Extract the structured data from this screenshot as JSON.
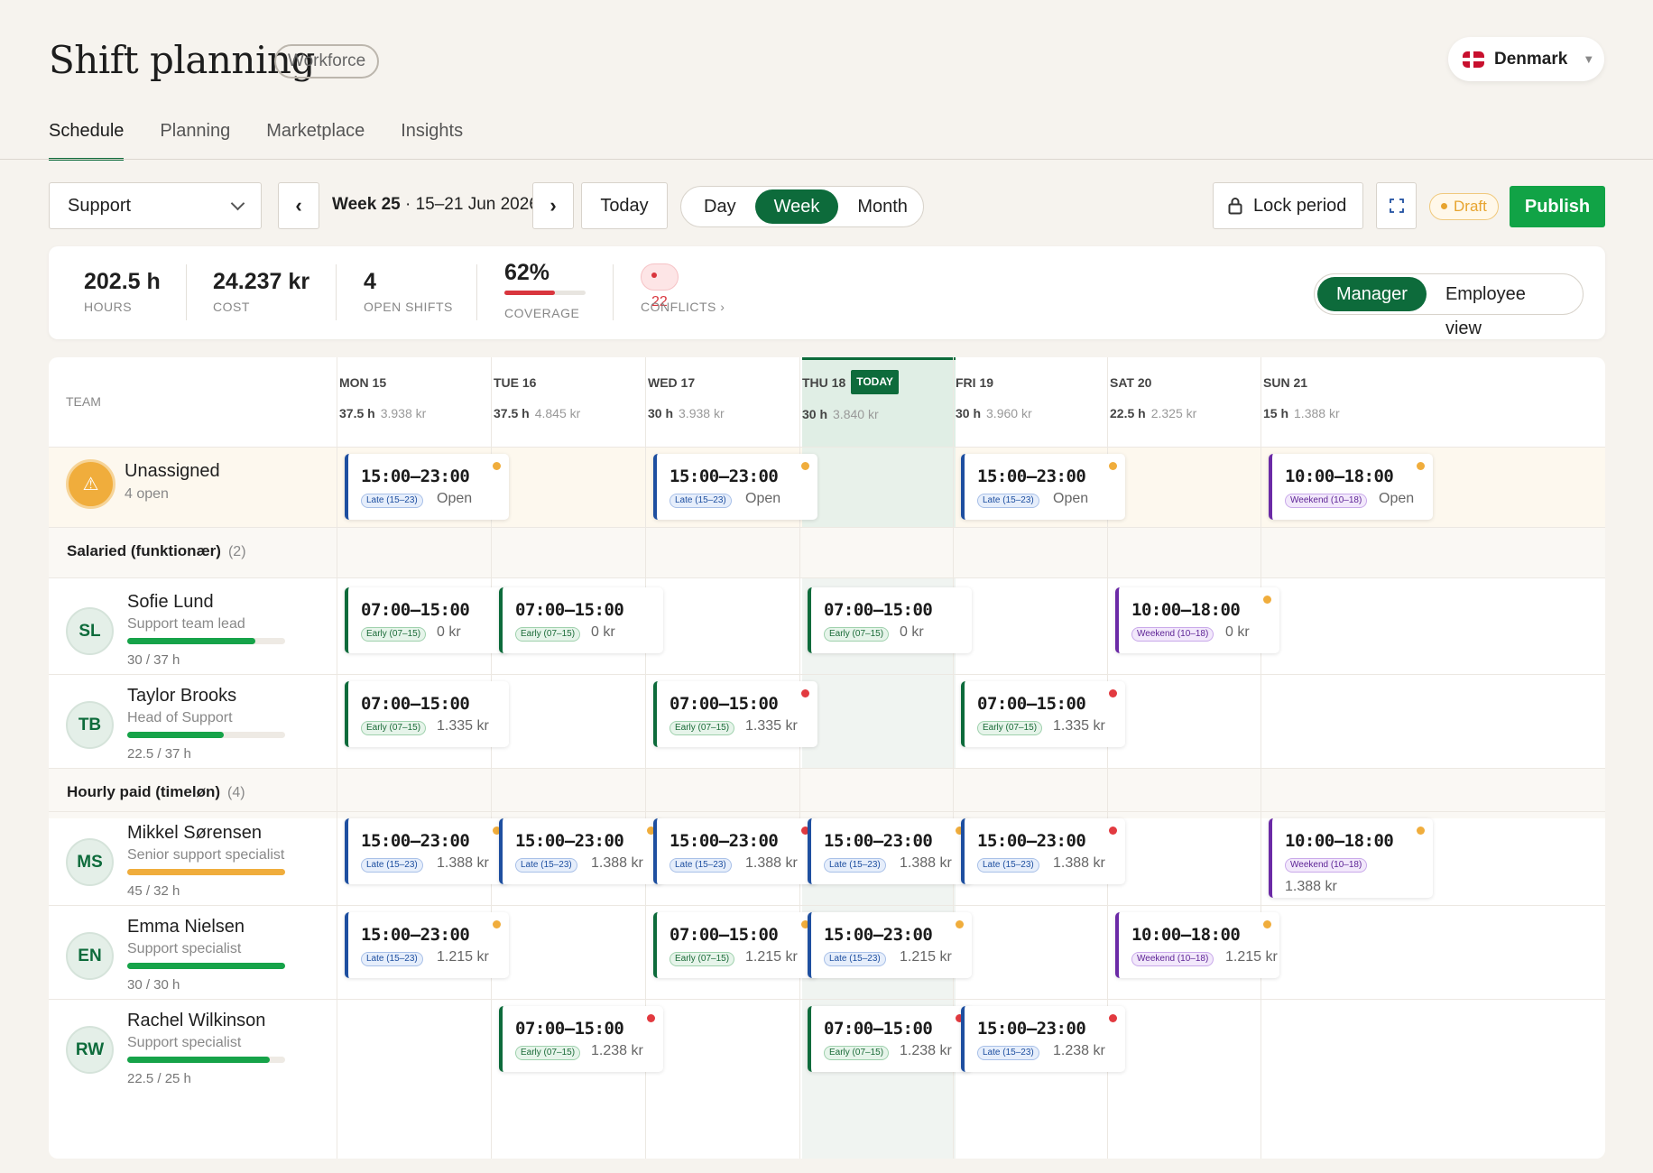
{
  "header": {
    "title": "Shift planning",
    "badge": "Workforce",
    "country": "Denmark"
  },
  "tabs": [
    "Schedule",
    "Planning",
    "Marketplace",
    "Insights"
  ],
  "toolbar": {
    "team": "Support",
    "prev": "‹",
    "next": "›",
    "week_bold": "Week 25",
    "week_range": " · 15–21 Jun 2026",
    "today": "Today",
    "views": [
      "Day",
      "Week",
      "Month"
    ],
    "active_view": "Week",
    "lock": "Lock period",
    "draft": "Draft",
    "publish": "Publish"
  },
  "stats": {
    "hours": {
      "value": "202.5 h",
      "label": "HOURS"
    },
    "cost": {
      "value": "24.237 kr",
      "label": "COST"
    },
    "open": {
      "value": "4",
      "label": "OPEN SHIFTS"
    },
    "coverage": {
      "value": "62%",
      "label": "COVERAGE",
      "percent": 62
    },
    "conflicts": {
      "value": "22",
      "label": "CONFLICTS ›"
    },
    "roles": [
      "Manager",
      "Employee view"
    ]
  },
  "grid": {
    "team_header": "TEAM",
    "today_badge": "TODAY",
    "days": [
      {
        "name": "MON 15",
        "hours": "37.5 h",
        "cost": "3.938 kr"
      },
      {
        "name": "TUE 16",
        "hours": "37.5 h",
        "cost": "4.845 kr"
      },
      {
        "name": "WED 17",
        "hours": "30 h",
        "cost": "3.938 kr"
      },
      {
        "name": "THU 18",
        "hours": "30 h",
        "cost": "3.840 kr"
      },
      {
        "name": "FRI 19",
        "hours": "30 h",
        "cost": "3.960 kr"
      },
      {
        "name": "SAT 20",
        "hours": "22.5 h",
        "cost": "2.325 kr"
      },
      {
        "name": "SUN 21",
        "hours": "15 h",
        "cost": "1.388 kr"
      }
    ],
    "unassigned": {
      "name": "Unassigned",
      "sub": "4 open"
    },
    "sections": [
      {
        "title": "Salaried (funktionær)",
        "count": "(2)"
      },
      {
        "title": "Hourly paid (timeløn)",
        "count": "(4)"
      }
    ],
    "people": [
      {
        "initials": "SL",
        "name": "Sofie Lund",
        "role": "Support team lead",
        "hours": "30 / 37 h",
        "utilization": 0.81
      },
      {
        "initials": "TB",
        "name": "Taylor Brooks",
        "role": "Head of Support",
        "hours": "22.5 / 37 h",
        "utilization": 0.61
      },
      {
        "initials": "MS",
        "name": "Mikkel Sørensen",
        "role": "Senior support specialist",
        "hours": "45 / 32 h",
        "utilization": 1.0,
        "over": true
      },
      {
        "initials": "EN",
        "name": "Emma Nielsen",
        "role": "Support specialist",
        "hours": "30 / 30 h",
        "utilization": 1.0
      },
      {
        "initials": "RW",
        "name": "Rachel Wilkinson",
        "role": "Support specialist",
        "hours": "22.5 / 25 h",
        "utilization": 0.9
      }
    ],
    "shifts": [
      {
        "row": 0,
        "day": 0,
        "time": "15:00–23:00",
        "tag": "Late (15–23)",
        "kind": "late",
        "info": "Open",
        "dot": "warn"
      },
      {
        "row": 0,
        "day": 2,
        "time": "15:00–23:00",
        "tag": "Late (15–23)",
        "kind": "late",
        "info": "Open",
        "dot": "warn"
      },
      {
        "row": 0,
        "day": 4,
        "time": "15:00–23:00",
        "tag": "Late (15–23)",
        "kind": "late",
        "info": "Open",
        "dot": "warn"
      },
      {
        "row": 0,
        "day": 6,
        "time": "10:00–18:00",
        "tag": "Weekend (10–18)",
        "kind": "weekend",
        "info": "Open",
        "dot": "warn"
      },
      {
        "row": 1,
        "day": 0,
        "time": "07:00–15:00",
        "tag": "Early (07–15)",
        "kind": "early",
        "info": "0 kr",
        "dot": ""
      },
      {
        "row": 1,
        "day": 1,
        "time": "07:00–15:00",
        "tag": "Early (07–15)",
        "kind": "early",
        "info": "0 kr",
        "dot": ""
      },
      {
        "row": 1,
        "day": 3,
        "time": "07:00–15:00",
        "tag": "Early (07–15)",
        "kind": "early",
        "info": "0 kr",
        "dot": ""
      },
      {
        "row": 1,
        "day": 5,
        "time": "10:00–18:00",
        "tag": "Weekend (10–18)",
        "kind": "weekend",
        "info": "0 kr",
        "dot": "warn"
      },
      {
        "row": 2,
        "day": 0,
        "time": "07:00–15:00",
        "tag": "Early (07–15)",
        "kind": "early",
        "info": "1.335 kr",
        "dot": ""
      },
      {
        "row": 2,
        "day": 2,
        "time": "07:00–15:00",
        "tag": "Early (07–15)",
        "kind": "early",
        "info": "1.335 kr",
        "dot": "err"
      },
      {
        "row": 2,
        "day": 4,
        "time": "07:00–15:00",
        "tag": "Early (07–15)",
        "kind": "early",
        "info": "1.335 kr",
        "dot": "err"
      },
      {
        "row": 3,
        "day": 0,
        "time": "15:00–23:00",
        "tag": "Late (15–23)",
        "kind": "late",
        "info": "1.388 kr",
        "dot": "warn"
      },
      {
        "row": 3,
        "day": 1,
        "time": "15:00–23:00",
        "tag": "Late (15–23)",
        "kind": "late",
        "info": "1.388 kr",
        "dot": "warn"
      },
      {
        "row": 3,
        "day": 2,
        "time": "15:00–23:00",
        "tag": "Late (15–23)",
        "kind": "late",
        "info": "1.388 kr",
        "dot": "err"
      },
      {
        "row": 3,
        "day": 3,
        "time": "15:00–23:00",
        "tag": "Late (15–23)",
        "kind": "late",
        "info": "1.388 kr",
        "dot": "warn"
      },
      {
        "row": 3,
        "day": 4,
        "time": "15:00–23:00",
        "tag": "Late (15–23)",
        "kind": "late",
        "info": "1.388 kr",
        "dot": "err"
      },
      {
        "row": 3,
        "day": 6,
        "time": "10:00–18:00",
        "tag": "Weekend (10–18)",
        "kind": "weekend",
        "info": "1.388 kr",
        "dot": "warn",
        "stack": true
      },
      {
        "row": 4,
        "day": 0,
        "time": "15:00–23:00",
        "tag": "Late (15–23)",
        "kind": "late",
        "info": "1.215 kr",
        "dot": "warn"
      },
      {
        "row": 4,
        "day": 2,
        "time": "07:00–15:00",
        "tag": "Early (07–15)",
        "kind": "early",
        "info": "1.215 kr",
        "dot": "warn"
      },
      {
        "row": 4,
        "day": 3,
        "time": "15:00–23:00",
        "tag": "Late (15–23)",
        "kind": "late",
        "info": "1.215 kr",
        "dot": "warn"
      },
      {
        "row": 4,
        "day": 5,
        "time": "10:00–18:00",
        "tag": "Weekend (10–18)",
        "kind": "weekend",
        "info": "1.215 kr",
        "dot": "warn"
      },
      {
        "row": 5,
        "day": 1,
        "time": "07:00–15:00",
        "tag": "Early (07–15)",
        "kind": "early",
        "info": "1.238 kr",
        "dot": "err"
      },
      {
        "row": 5,
        "day": 3,
        "time": "07:00–15:00",
        "tag": "Early (07–15)",
        "kind": "early",
        "info": "1.238 kr",
        "dot": "err"
      },
      {
        "row": 5,
        "day": 4,
        "time": "15:00–23:00",
        "tag": "Late (15–23)",
        "kind": "late",
        "info": "1.238 kr",
        "dot": "err"
      }
    ]
  },
  "colors": {
    "accent": "#0d6b3b",
    "publish": "#11a346",
    "warning": "#f0ad3c",
    "error": "#e23a40",
    "late": "#1e4fa0",
    "weekend": "#6b2aa6"
  }
}
